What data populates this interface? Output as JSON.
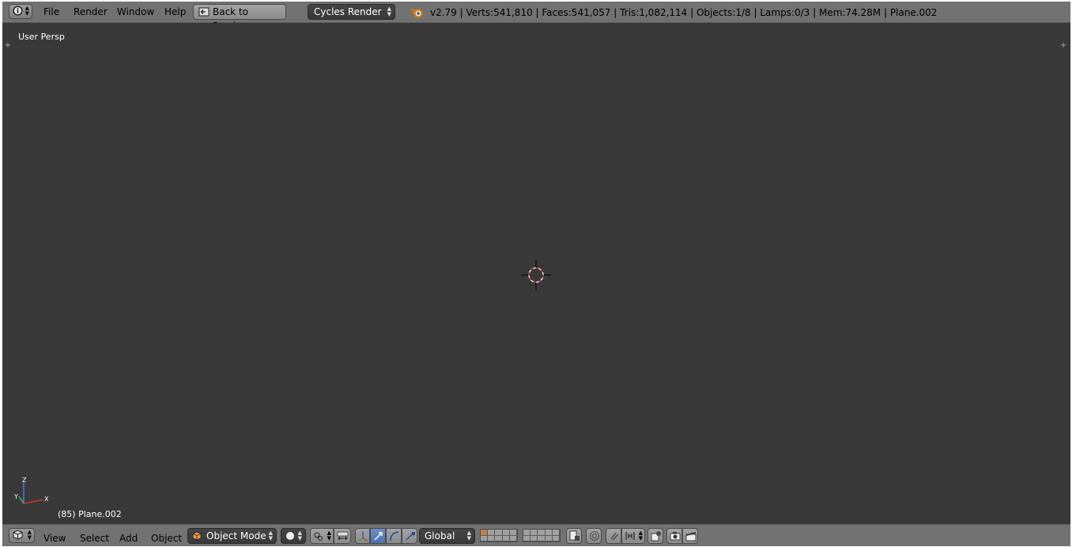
{
  "top_menu": {
    "items": [
      "File",
      "Render",
      "Window",
      "Help"
    ],
    "back_button": "Back to Previous",
    "render_engine": "Cycles Render",
    "stats": "v2.79 | Verts:541,810 | Faces:541,057 | Tris:1,082,114 | Objects:1/8 | Lamps:0/3 | Mem:74.28M | Plane.002"
  },
  "viewport": {
    "view_name": "User Persp",
    "object_info": "(85) Plane.002",
    "background_color": "#393939",
    "axis_labels": {
      "x": "X",
      "y": "Y",
      "z": "Z"
    }
  },
  "bottom_menu": {
    "items": [
      "View",
      "Select",
      "Add",
      "Object"
    ],
    "mode": "Object Mode",
    "orientation": "Global"
  },
  "colors": {
    "header": "#727272",
    "accent_blue": "#5680c2"
  }
}
